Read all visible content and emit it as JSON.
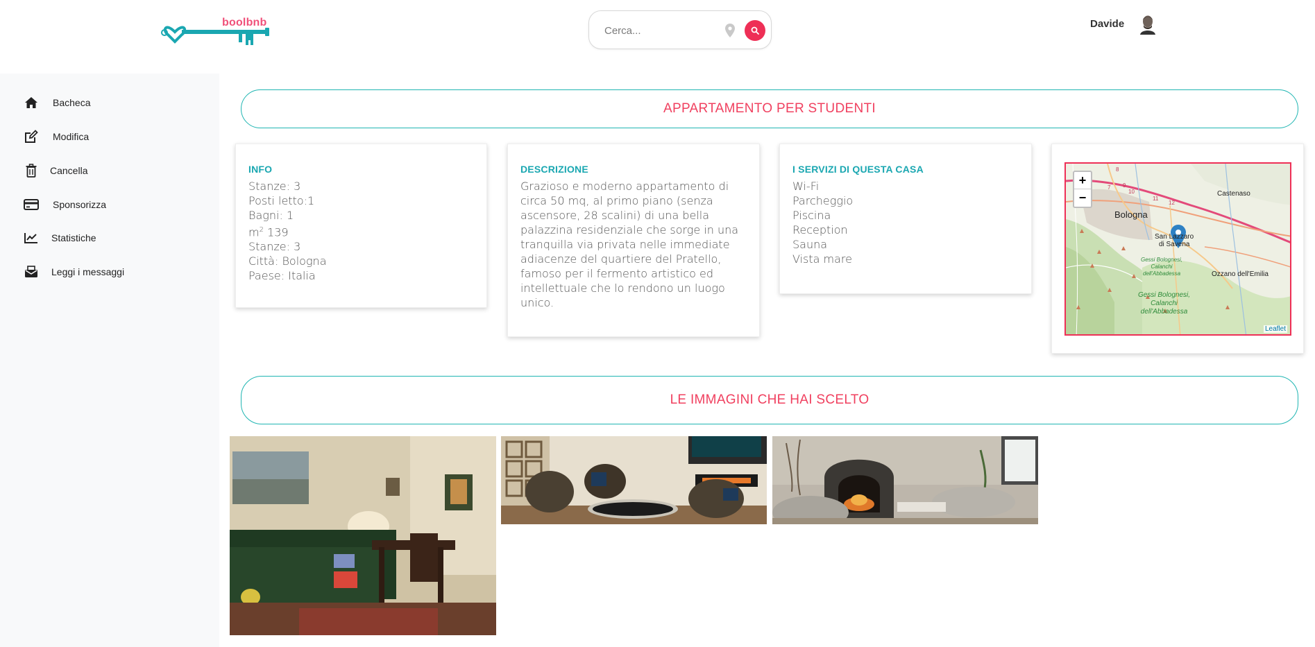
{
  "app": {
    "logo_text": "boolbnb"
  },
  "header": {
    "search_placeholder": "Cerca...",
    "user_name": "Davide"
  },
  "sidebar": {
    "items": [
      {
        "label": "Bacheca",
        "icon": "home-icon"
      },
      {
        "label": "Modifica",
        "icon": "edit-icon"
      },
      {
        "label": "Cancella",
        "icon": "trash-icon"
      },
      {
        "label": "Sponsorizza",
        "icon": "credit-card-icon"
      },
      {
        "label": "Statistiche",
        "icon": "chart-line-icon"
      },
      {
        "label": "Leggi i messaggi",
        "icon": "mail-bulk-icon"
      }
    ]
  },
  "apartment": {
    "title": "APPARTAMENTO PER STUDENTI",
    "info": {
      "heading": "INFO",
      "rooms": "Stanze: 3",
      "beds": "Posti letto:1",
      "baths": "Bagni: 1",
      "sqm_unit": "m",
      "sqm_sup": "2",
      "sqm_value": " 139",
      "rooms2": "Stanze: 3",
      "city": "Città: Bologna",
      "country": "Paese: Italia"
    },
    "description": {
      "heading": "DESCRIZIONE",
      "text": "Grazioso e moderno appartamento di circa 50 mq, al primo piano (senza ascensore, 28 scalini) di una bella palazzina residenziale che sorge in una tranquilla via privata nelle immediate adiacenze del quartiere del Pratello, famoso per il fermento artistico ed intellettuale che lo rendono un luogo unico."
    },
    "services": {
      "heading": "I SERVIZI DI QUESTA CASA",
      "items": [
        "Wi-Fi",
        "Parcheggio",
        "Piscina",
        "Reception",
        "Sauna",
        "Vista mare"
      ]
    },
    "map": {
      "zoom_in": "+",
      "zoom_out": "−",
      "attribution": "Leaflet",
      "labels": {
        "bologna": "Bologna",
        "castenaso": "Castenaso",
        "san_lazzaro_1": "San Lazzaro",
        "san_lazzaro_2": "di Savena",
        "ozzano": "Ozzano dell'Emilia",
        "gessi_a_1": "Gessi Bolognesi,",
        "gessi_a_2": "Calanchi",
        "gessi_a_3": "dell'Abbadessa",
        "gessi_b_1": "Gessi Bolognesi,",
        "gessi_b_2": "Calanchi",
        "gessi_b_3": "dell'Abbadessa",
        "road_a": "9",
        "road_b": "10",
        "road_c": "8",
        "road_d": "11",
        "road_e": "12",
        "road_f": "7"
      }
    }
  },
  "images_section": {
    "title": "LE IMMAGINI CHE HAI SCELTO"
  }
}
